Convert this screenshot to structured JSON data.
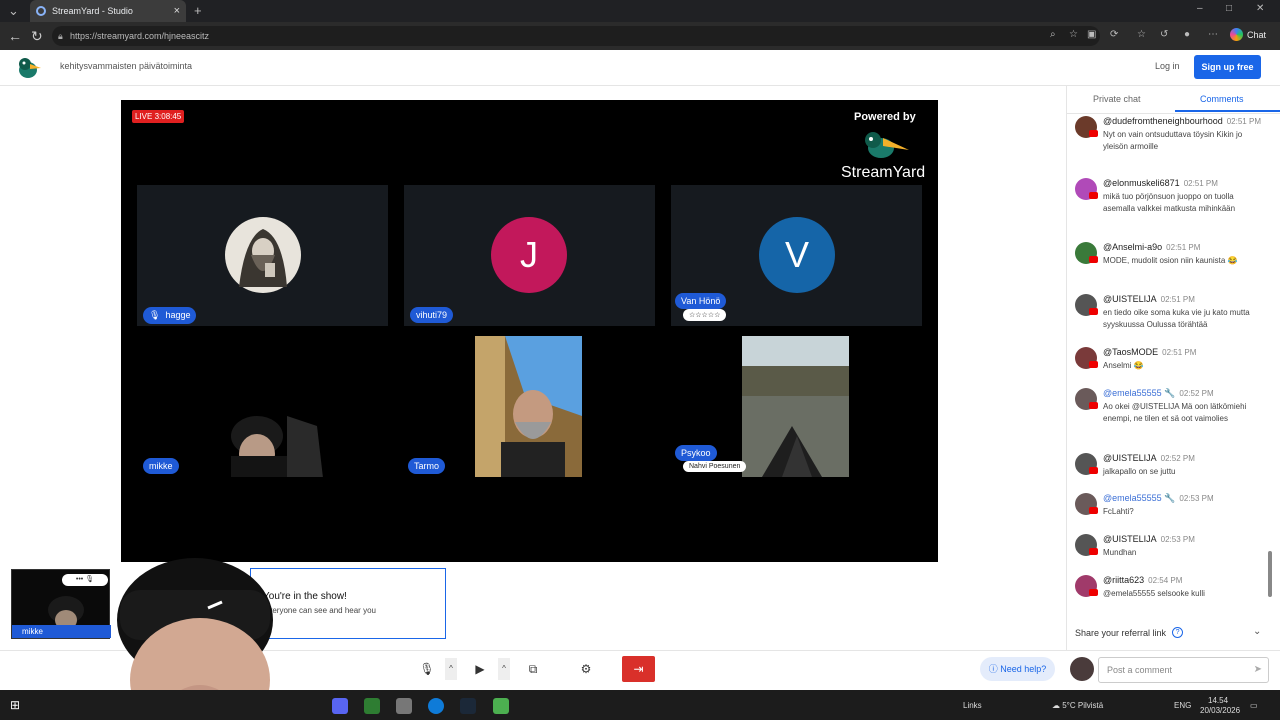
{
  "browser": {
    "tab_title": "StreamYard - Studio",
    "new_tab": "+",
    "url": "https://streamyard.com/hjneeascitz",
    "chat_label": "Chat"
  },
  "header": {
    "subtitle": "kehitysvammaisten päivätoiminta",
    "login": "Log in",
    "signup": "Sign up free"
  },
  "stage": {
    "live_badge": "LIVE 3:08:45",
    "powered_by": "Powered by",
    "brand": "StreamYard",
    "participants": [
      {
        "name": "hagge",
        "muted": true
      },
      {
        "name": "vihuti79",
        "initial": "J",
        "color": "#c2185b"
      },
      {
        "name": "Van Hönö",
        "initial": "V",
        "color": "#1565a8",
        "badge": "☆☆☆☆☆"
      },
      {
        "name": "mikke"
      },
      {
        "name": "Tarmo"
      },
      {
        "name": "Psykoo",
        "badge": "Nahvi Poesunen"
      }
    ]
  },
  "toast": {
    "title": "You're in the show!",
    "subtitle": "Everyone can see and hear you"
  },
  "preview": {
    "name": "mikke"
  },
  "controls": {
    "help": "Need help?"
  },
  "panel": {
    "tab_private": "Private chat",
    "tab_comments": "Comments",
    "referral": "Share your referral link",
    "comment_placeholder": "Post a comment",
    "comments": [
      {
        "user": "@dudefromtheneighbourhood",
        "time": "02:51 PM",
        "text": "Nyt on vain ontsuduttava töysin Kikin jo yleisön armoille",
        "avatar": "#6b3a2a"
      },
      {
        "user": "@elonmuskeli6871",
        "time": "02:51 PM",
        "text": "mikä tuo pörjönsuon juoppo on tuolla asemalla valkkei matkusta mihinkään",
        "avatar": "#b04ab8"
      },
      {
        "user": "@Anselmi-a9o",
        "time": "02:51 PM",
        "text": "MODE, mudolit osion niin kaunista 😂",
        "avatar": "#3a7a3a"
      },
      {
        "user": "@UISTELIJA",
        "time": "02:51 PM",
        "text": "en tiedo oike soma kuka vie ju kato mutta syyskuussa Oulussa törähtää",
        "avatar": "#555555"
      },
      {
        "user": "@TaosMODE",
        "time": "02:51 PM",
        "text": "Anselmi 😂",
        "avatar": "#7a3a3a"
      },
      {
        "user": "@emela55555 🔧",
        "time": "02:52 PM",
        "text": "Ao okei @UISTELIJA Mä oon lätkömiehi enempi, ne tilen et sä oot vaimolies",
        "avatar": "#6a5a5a",
        "alt": true
      },
      {
        "user": "@UISTELIJA",
        "time": "02:52 PM",
        "text": "jalkapallo on se juttu",
        "avatar": "#555555"
      },
      {
        "user": "@emela55555 🔧",
        "time": "02:53 PM",
        "text": "FcLahti?",
        "avatar": "#6a5a5a",
        "alt": true
      },
      {
        "user": "@UISTELIJA",
        "time": "02:53 PM",
        "text": "Mundhan",
        "avatar": "#555555"
      },
      {
        "user": "@riitta623",
        "time": "02:54 PM",
        "text": "@emela55555 selsooke kulli",
        "avatar": "#a03a6a"
      }
    ]
  },
  "taskbar": {
    "links": "Links",
    "weather": "5°C Pilvistä",
    "lang": "ENG",
    "time": "14.54",
    "date": "20/03/2026"
  }
}
